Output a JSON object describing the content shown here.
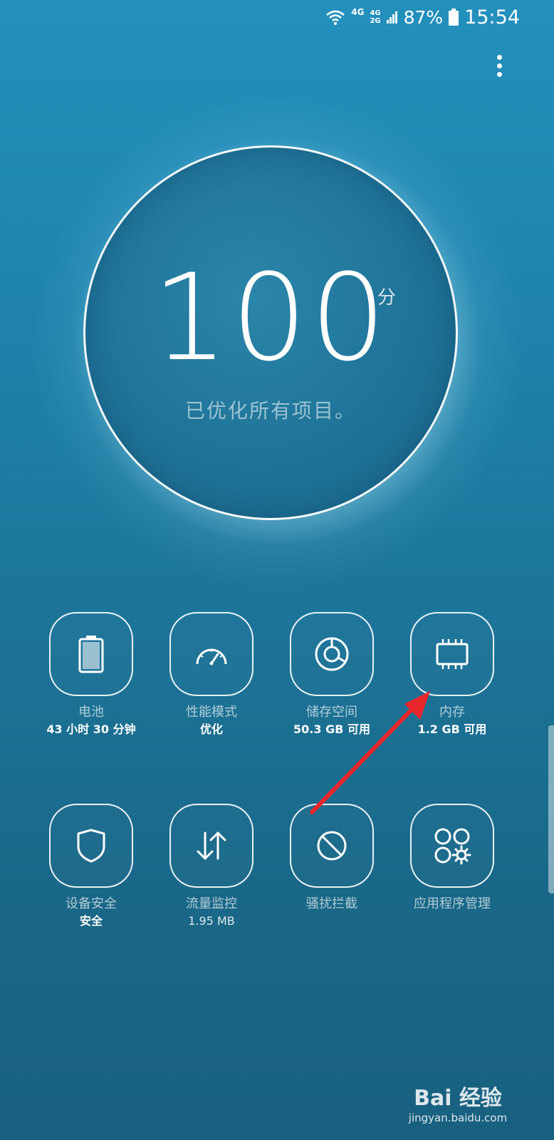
{
  "status_bar": {
    "net1": "4G",
    "net2_top": "4G",
    "net2_bottom": "2G",
    "battery": "87%",
    "time": "15:54"
  },
  "score": {
    "value": "100",
    "unit": "分",
    "description": "已优化所有项目。"
  },
  "tiles": [
    {
      "label": "电池",
      "value": "43 小时 30 分钟",
      "icon": "battery-icon"
    },
    {
      "label": "性能模式",
      "value": "优化",
      "icon": "speedometer-icon"
    },
    {
      "label": "储存空间",
      "value": "50.3 GB 可用",
      "icon": "storage-icon"
    },
    {
      "label": "内存",
      "value": "1.2 GB 可用",
      "icon": "memory-chip-icon"
    },
    {
      "label": "设备安全",
      "value": "安全",
      "icon": "shield-icon"
    },
    {
      "label": "流量监控",
      "value": "1.95 MB",
      "icon": "data-transfer-icon"
    },
    {
      "label": "骚扰拦截",
      "value": "",
      "icon": "block-icon"
    },
    {
      "label": "应用程序管理",
      "value": "",
      "icon": "app-management-icon"
    }
  ],
  "watermark": {
    "brand": "Bai 经验",
    "site": "jingyan.baidu.com"
  },
  "colors": {
    "annotation_arrow": "#e8262b",
    "background_top": "#2390bd",
    "background_bottom": "#18607f"
  }
}
